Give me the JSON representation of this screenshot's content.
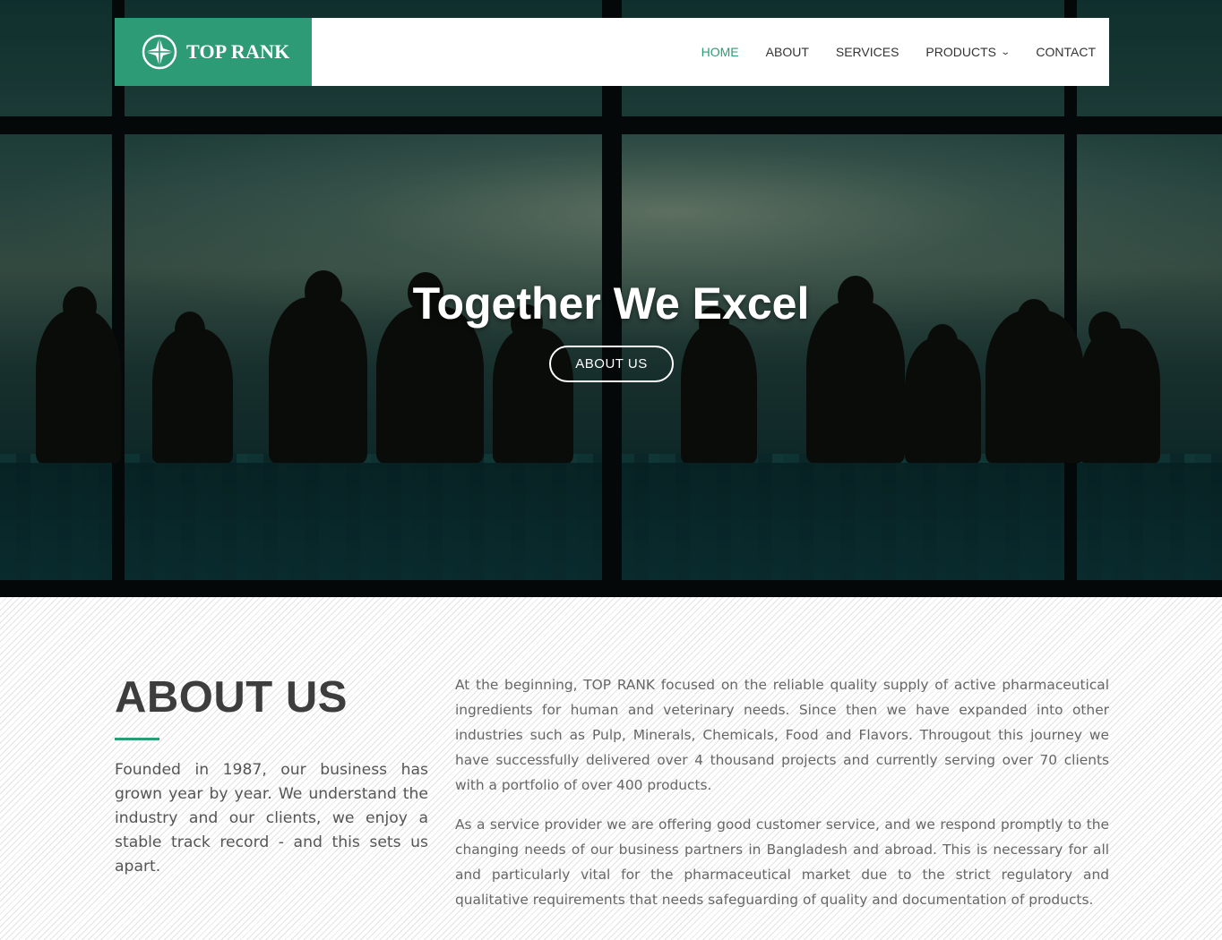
{
  "brand": {
    "name": "TOP RANK",
    "color": "#2e9b77"
  },
  "nav": {
    "items": [
      {
        "label": "HOME",
        "active": true
      },
      {
        "label": "ABOUT",
        "active": false
      },
      {
        "label": "SERVICES",
        "active": false
      },
      {
        "label": "PRODUCTS",
        "active": false,
        "has_dropdown": true
      },
      {
        "label": "CONTACT",
        "active": false
      }
    ]
  },
  "hero": {
    "title": "Together We Excel",
    "button_label": "ABOUT US"
  },
  "about": {
    "title": "ABOUT US",
    "lead": "Founded in 1987, our business has grown year by year. We understand the industry and our clients, we enjoy a stable track record - and this sets us apart.",
    "paragraphs": [
      "At the beginning, TOP RANK focused on the reliable quality supply of active pharmaceutical ingredients for human and veterinary needs. Since then we have expanded into other industries such as Pulp, Minerals, Chemicals, Food and Flavors. Througout this journey we have successfully delivered over 4 thousand projects and currently serving over 70 clients with a portfolio of over 400 products.",
      "As a service provider we are offering good customer service, and we respond promptly to the changing needs of our business partners in Bangladesh and abroad. This is necessary for all and particularly vital for the pharmaceutical market due to the strict regulatory and qualitative requirements that needs safeguarding of quality and documentation of products."
    ]
  }
}
